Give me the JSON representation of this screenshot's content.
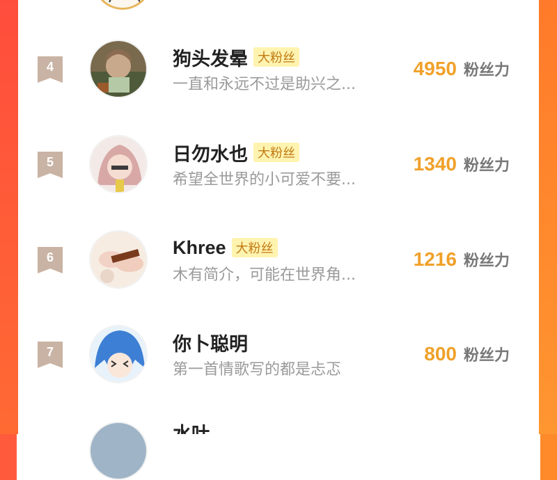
{
  "list": {
    "count_label": "粉丝力",
    "badge_label": "大粉丝",
    "items": [
      {
        "rank": "4",
        "name": "狗头发晕",
        "badge": "大粉丝",
        "bio": "一直和永远不过是助兴之...",
        "count": "4950"
      },
      {
        "rank": "5",
        "name": "日勿水也",
        "badge": "大粉丝",
        "bio": "希望全世界的小可爱不要...",
        "count": "1340"
      },
      {
        "rank": "6",
        "name": "Khree",
        "badge": "大粉丝",
        "bio": "木有简介，可能在世界角...",
        "count": "1216"
      },
      {
        "rank": "7",
        "name": "你卜聪明",
        "badge": "",
        "bio": "第一首情歌写的都是忐忑",
        "count": "800"
      }
    ],
    "next_partial_name": "水吐"
  },
  "colors": {
    "accent_count": "#f0a12a",
    "rank_flag": "#c9b3a4",
    "badge_bg": "#fff3b0",
    "side_left": "#ff4d3d",
    "side_right": "#ff9630"
  },
  "icons": [
    "rank-flag-icon",
    "avatar-image"
  ]
}
